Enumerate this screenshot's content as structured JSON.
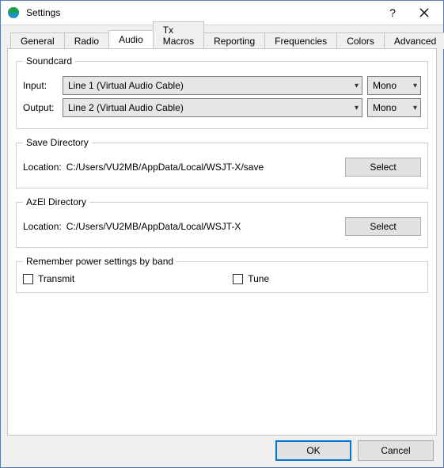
{
  "window": {
    "title": "Settings"
  },
  "tabs": {
    "general": "General",
    "radio": "Radio",
    "audio": "Audio",
    "txmacros": "Tx Macros",
    "reporting": "Reporting",
    "frequencies": "Frequencies",
    "colors": "Colors",
    "advanced": "Advanced"
  },
  "soundcard": {
    "legend": "Soundcard",
    "input_label": "Input:",
    "input_value": "Line 1 (Virtual Audio Cable)",
    "input_channels": "Mono",
    "output_label": "Output:",
    "output_value": "Line 2 (Virtual Audio Cable)",
    "output_channels": "Mono"
  },
  "savedir": {
    "legend": "Save Directory",
    "location_label": "Location:",
    "location_value": "C:/Users/VU2MB/AppData/Local/WSJT-X/save",
    "select": "Select"
  },
  "azeldir": {
    "legend": "AzEl Directory",
    "location_label": "Location:",
    "location_value": "C:/Users/VU2MB/AppData/Local/WSJT-X",
    "select": "Select"
  },
  "power": {
    "legend": "Remember power settings by band",
    "transmit": "Transmit",
    "tune": "Tune"
  },
  "footer": {
    "ok": "OK",
    "cancel": "Cancel"
  }
}
